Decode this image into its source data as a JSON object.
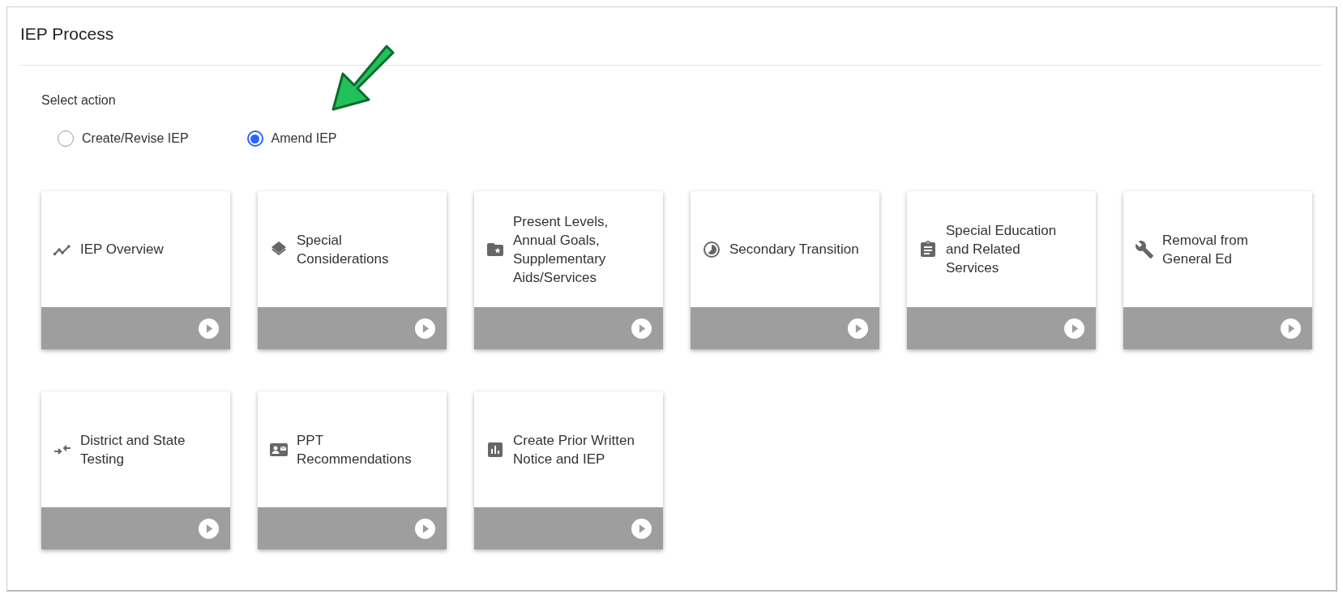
{
  "title": "IEP Process",
  "prompt": "Select action",
  "options": [
    {
      "label": "Create/Revise IEP",
      "selected": false
    },
    {
      "label": "Amend IEP",
      "selected": true
    }
  ],
  "tiles": [
    {
      "label": "IEP Overview"
    },
    {
      "label": "Special Considerations"
    },
    {
      "label": "Present Levels, Annual Goals, Supplementary Aids/Services"
    },
    {
      "label": "Secondary Transition"
    },
    {
      "label": "Special Education and Related Services"
    },
    {
      "label": "Removal from General Ed"
    },
    {
      "label": "District and State Testing"
    },
    {
      "label": "PPT Recommendations"
    },
    {
      "label": "Create Prior Written Notice and IEP"
    }
  ]
}
